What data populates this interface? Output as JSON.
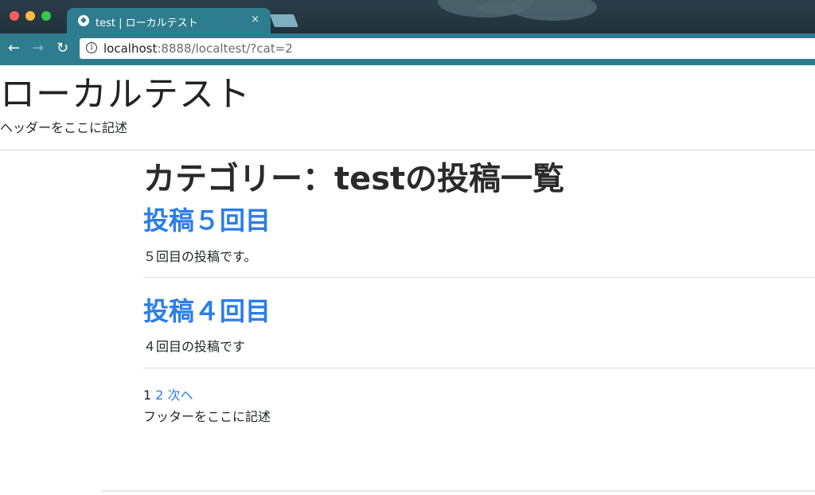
{
  "browser": {
    "tab_title": "test | ローカルテスト",
    "tab_close": "×",
    "url_host": "localhost",
    "url_rest": ":8888/localtest/?cat=2",
    "back_icon": "←",
    "forward_icon": "→",
    "reload_icon": "↻",
    "info_icon": "i"
  },
  "site": {
    "title": "ローカルテスト",
    "header_text": "ヘッダーをここに記述"
  },
  "main": {
    "category_heading": "カテゴリー：testの投稿一覧",
    "posts": [
      {
        "title": "投稿５回目",
        "excerpt": "５回目の投稿です。"
      },
      {
        "title": "投稿４回目",
        "excerpt": "４回目の投稿です"
      }
    ],
    "pagination": {
      "current": "1",
      "page2": "2",
      "next": "次へ"
    }
  },
  "footer": {
    "text": "フッターをここに記述"
  }
}
